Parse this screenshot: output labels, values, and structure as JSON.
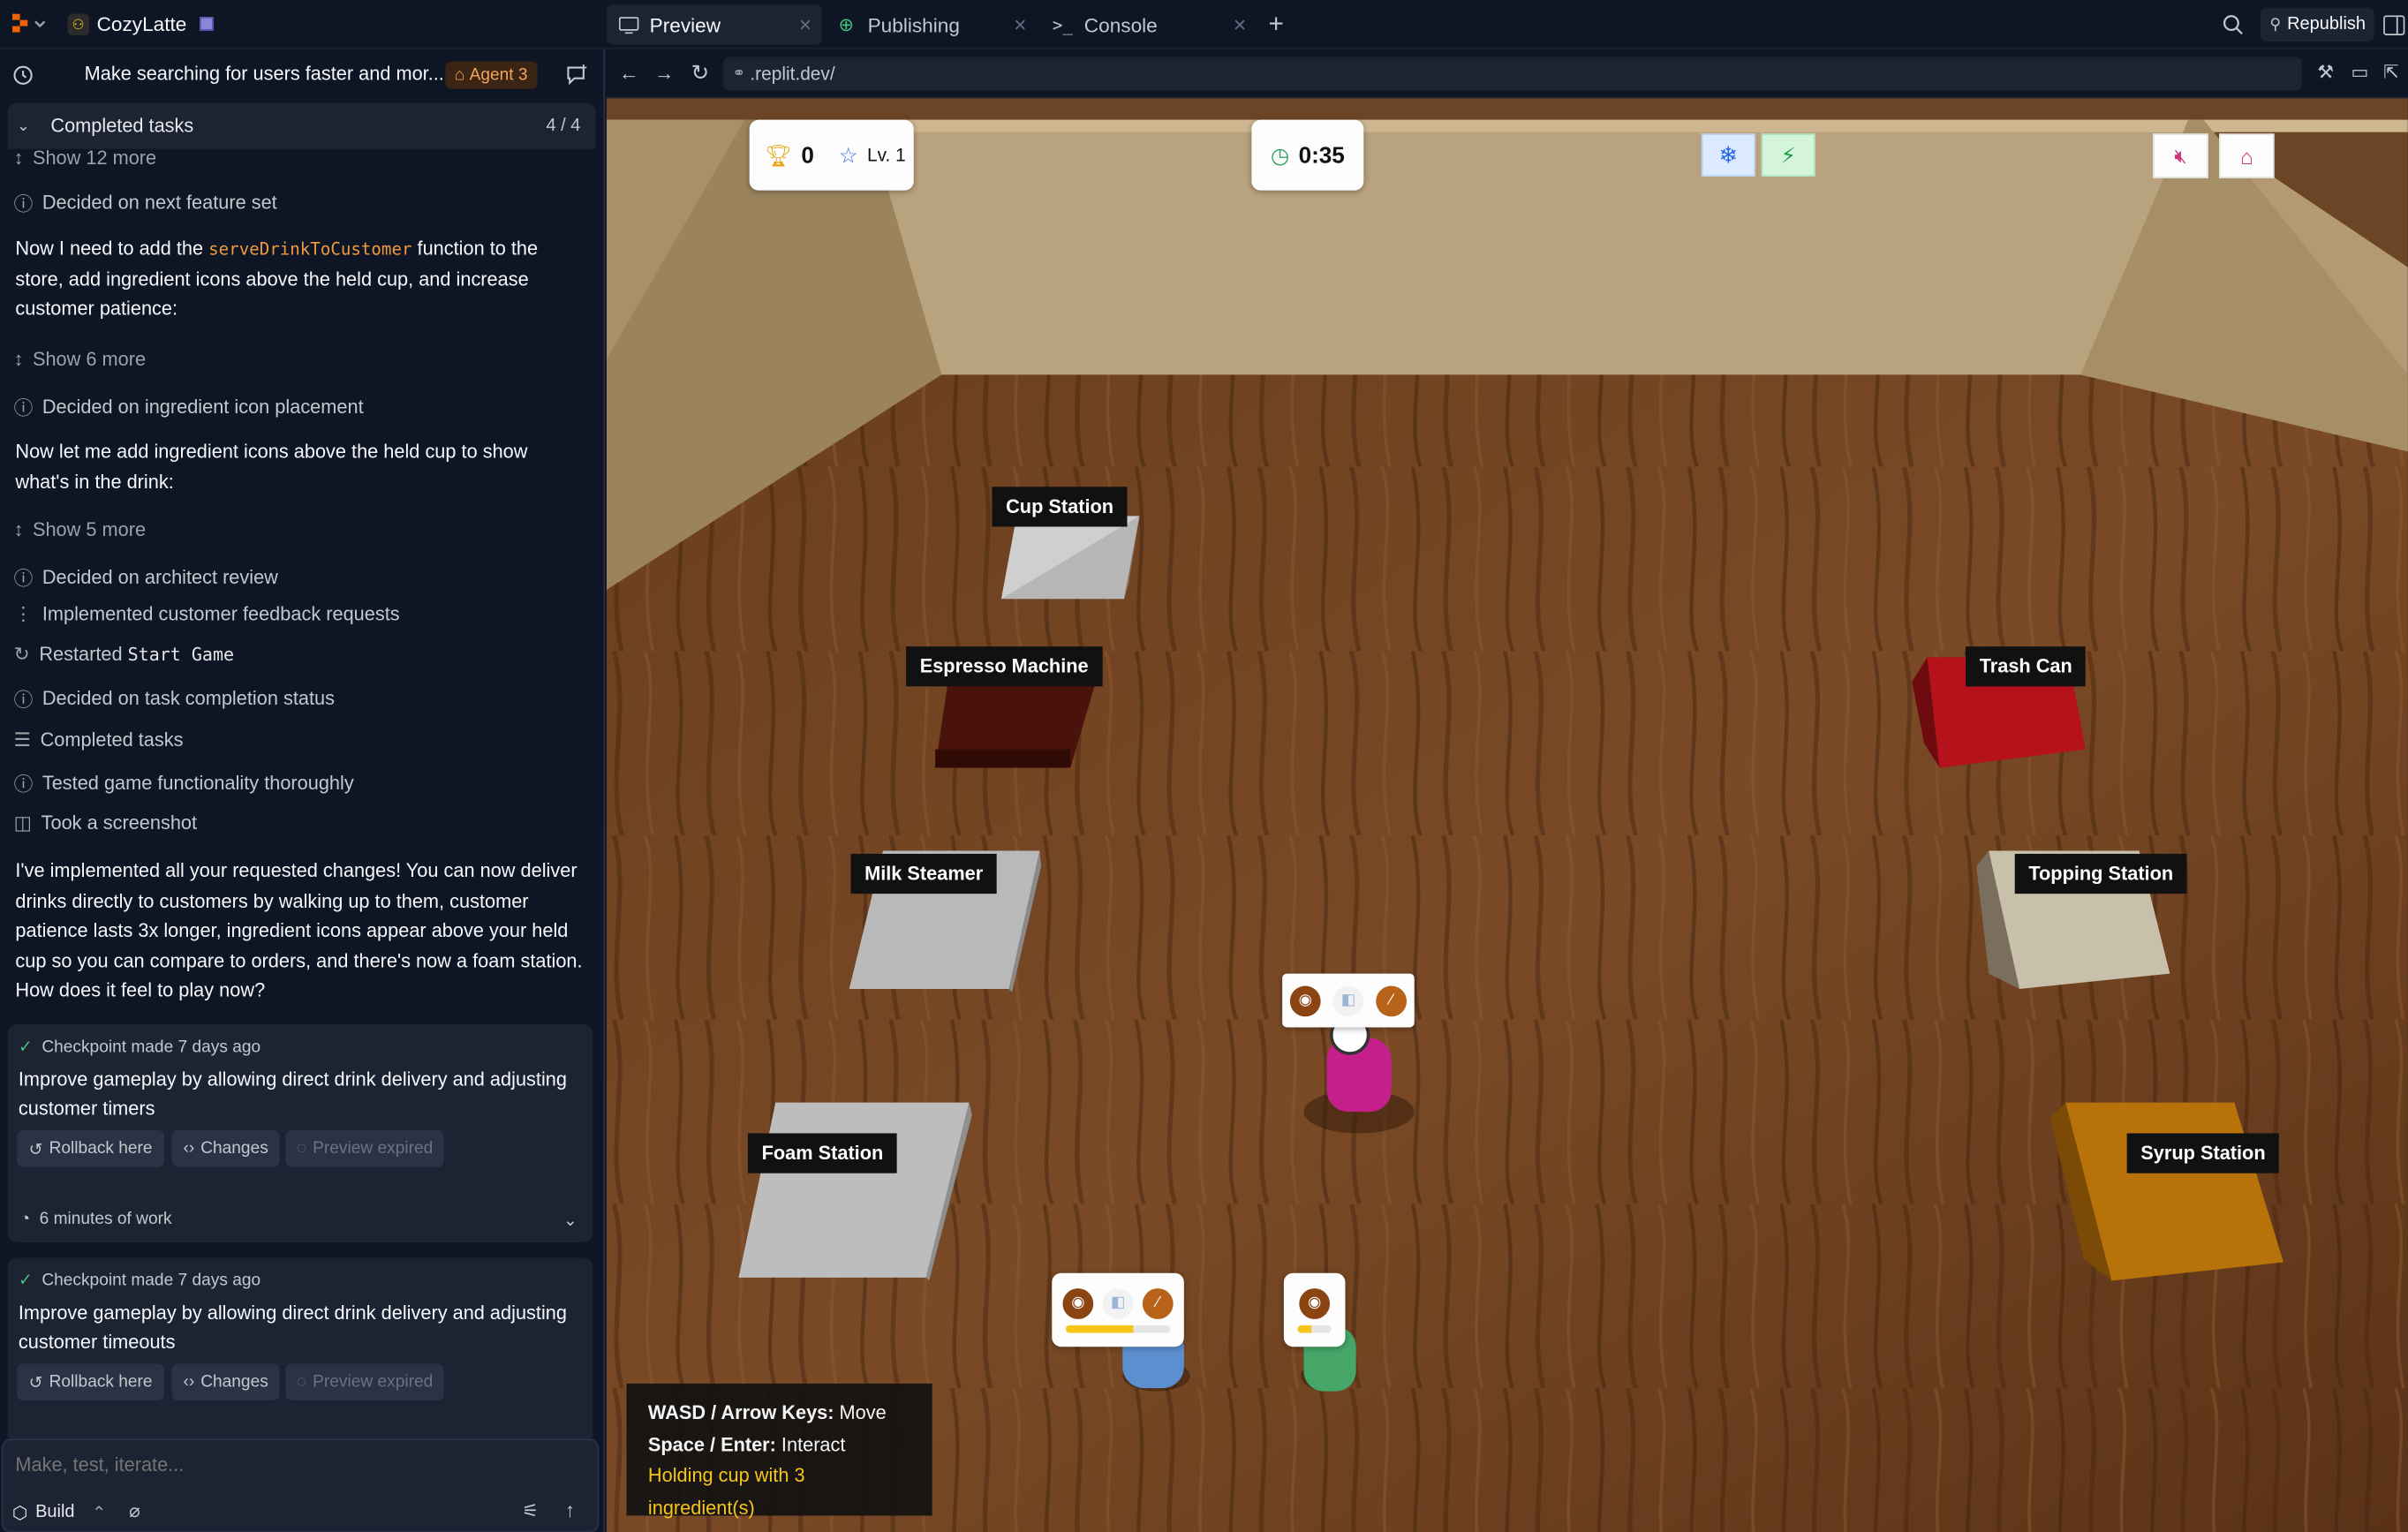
{
  "topbar": {
    "app_name": "CozyLatte",
    "tabs": [
      {
        "label": "Preview",
        "icon": "monitor-icon"
      },
      {
        "label": "Publishing",
        "icon": "globe-icon"
      },
      {
        "label": "Console",
        "icon": "terminal-icon"
      }
    ],
    "republish_label": "Republish"
  },
  "chat": {
    "title": "Make searching for users faster and mor...",
    "agent_badge": "Agent 3",
    "completed_tasks_label": "Completed tasks",
    "completed_tasks_count": "4 / 4",
    "show_more_top": "Show 12 more",
    "decided_feature": "Decided on next feature set",
    "para1_a": "Now I need to add the ",
    "para1_code": "serveDrinkToCustomer",
    "para1_b": " function to the store, add ingredient icons above the held cup, and increase customer patience:",
    "show_6": "Show 6 more",
    "decided_icon_placement": "Decided on ingredient icon placement",
    "para2": "Now let me add ingredient icons above the held cup to show what's in the drink:",
    "show_5": "Show 5 more",
    "decided_architect": "Decided on architect review",
    "implemented_feedback": "Implemented customer feedback requests",
    "restarted_prefix": "Restarted ",
    "restarted_code": "Start Game",
    "decided_completion": "Decided on task completion status",
    "completed_tasks": "Completed tasks",
    "tested": "Tested game functionality thoroughly",
    "screenshot": "Took a screenshot",
    "summary": "I've implemented all your requested changes! You can now deliver drinks directly to customers by walking up to them, customer patience lasts 3x longer, ingredient icons appear above your held cup so you can compare to orders, and there's now a foam station. How does it feel to play now?",
    "checkpoint1_meta": "Checkpoint made 7 days ago",
    "checkpoint1_text": "Improve gameplay by allowing direct drink delivery and adjusting customer timers",
    "rollback_label": "Rollback here",
    "changes_label": "Changes",
    "preview_expired_label": "Preview expired",
    "work_label": "6 minutes of work",
    "checkpoint2_meta": "Checkpoint made 7 days ago",
    "checkpoint2_text": "Improve gameplay by allowing direct drink delivery and adjusting customer timeouts",
    "input_placeholder": "Make, test, iterate...",
    "build_label": "Build"
  },
  "browser": {
    "url": ".replit.dev/"
  },
  "game": {
    "score": "0",
    "level": "Lv. 1",
    "timer": "0:35",
    "stations": {
      "cup": "Cup Station",
      "espresso": "Espresso Machine",
      "trash": "Trash Can",
      "milk": "Milk Steamer",
      "topping": "Topping Station",
      "foam": "Foam Station",
      "syrup": "Syrup Station"
    },
    "controls": {
      "move_key": "WASD / Arrow Keys:",
      "move_action": " Move",
      "interact_key": "Space / Enter:",
      "interact_action": " Interact",
      "status": "Holding cup with 3 ingredient(s)"
    },
    "customer1_patience": 0.65,
    "customer2_patience": 0.4,
    "colors": {
      "accent_orange": "#f09a3e",
      "status_yellow": "#f5c518",
      "trash_red": "#b5121b",
      "syrup_amber": "#b8720a"
    }
  }
}
